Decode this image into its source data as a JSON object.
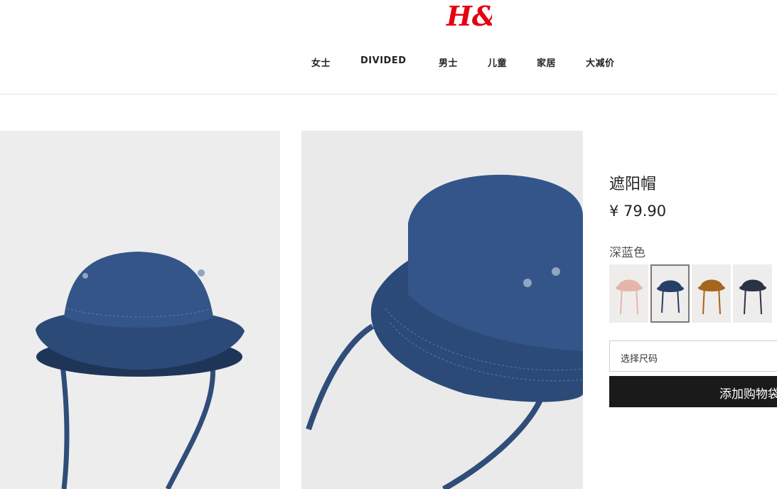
{
  "brand": {
    "logo_text": "H&M",
    "accent_color": "#e50010"
  },
  "nav": {
    "items": [
      "女士",
      "DIVIDED",
      "男士",
      "儿童",
      "家居",
      "大减价"
    ]
  },
  "product": {
    "title": "遮阳帽",
    "price": "¥ 79.90",
    "color_label": "深蓝色",
    "swatches": [
      {
        "name": "pink",
        "color": "#e6b5aa"
      },
      {
        "name": "navy",
        "color": "#263f66",
        "selected": true
      },
      {
        "name": "brown",
        "color": "#a6651d"
      },
      {
        "name": "dark-navy",
        "color": "#2a3346"
      }
    ],
    "size_placeholder": "选择尺码",
    "add_to_bag": "添加购物袋"
  }
}
